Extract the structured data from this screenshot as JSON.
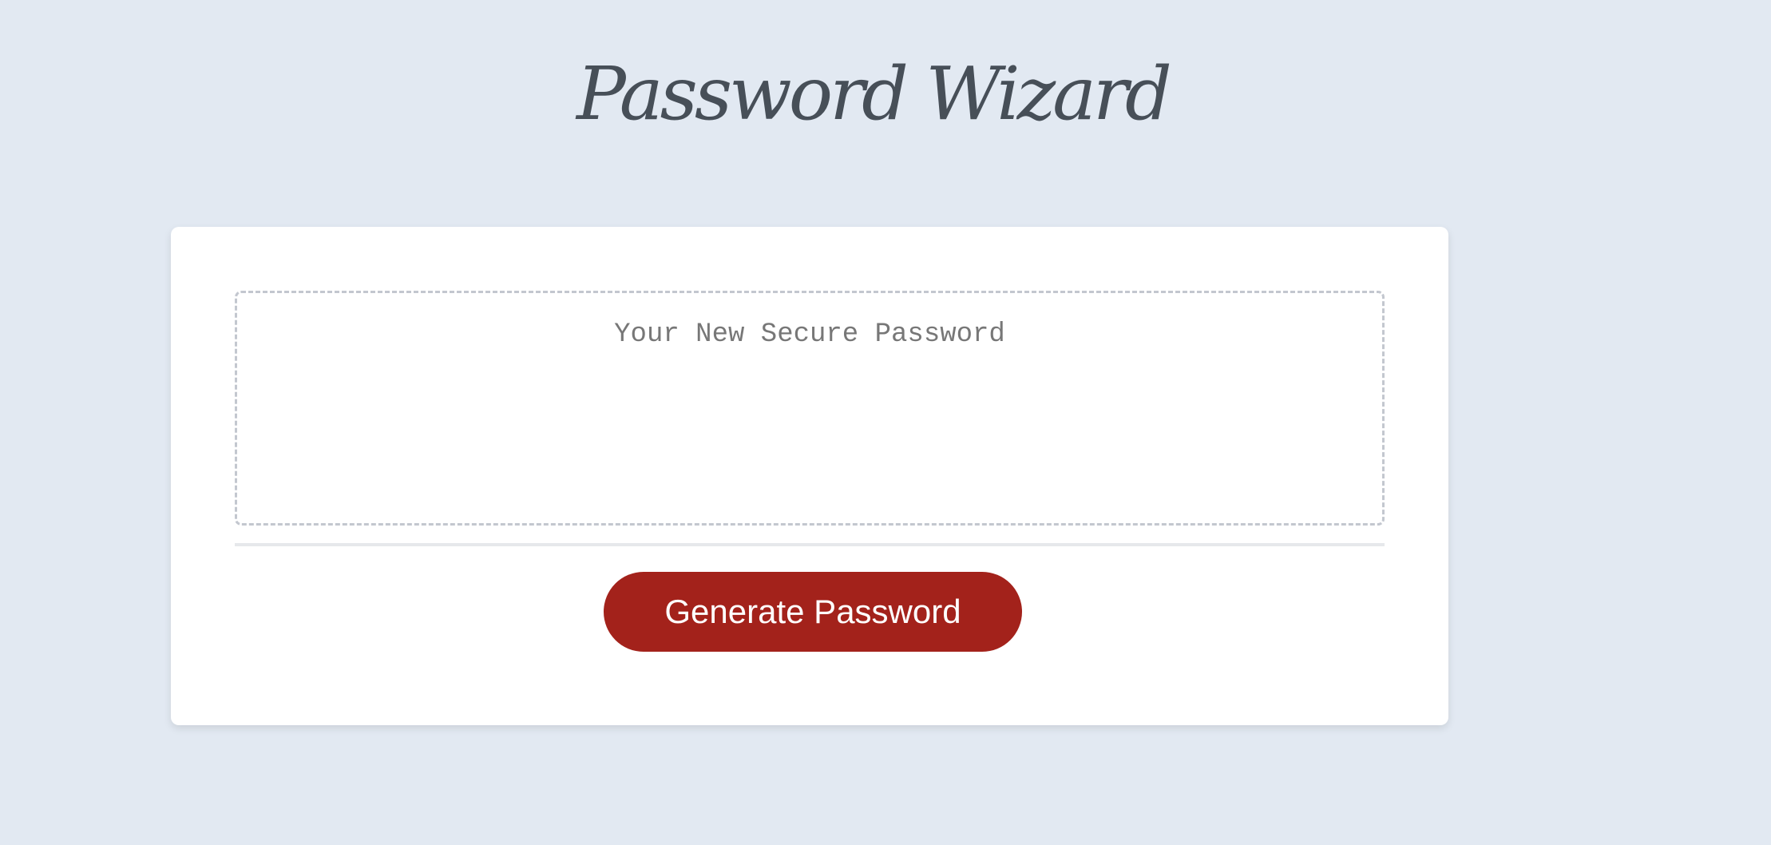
{
  "header": {
    "title": "Password Wizard"
  },
  "card": {
    "password_field": {
      "placeholder": "Your New Secure Password",
      "value": ""
    },
    "generate_button_label": "Generate Password"
  },
  "colors": {
    "page_background": "#e2e9f2",
    "card_background": "#ffffff",
    "title": "#474f58",
    "button_background": "#a3221b",
    "button_text": "#ffffff",
    "field_border": "#c3c7cf"
  }
}
